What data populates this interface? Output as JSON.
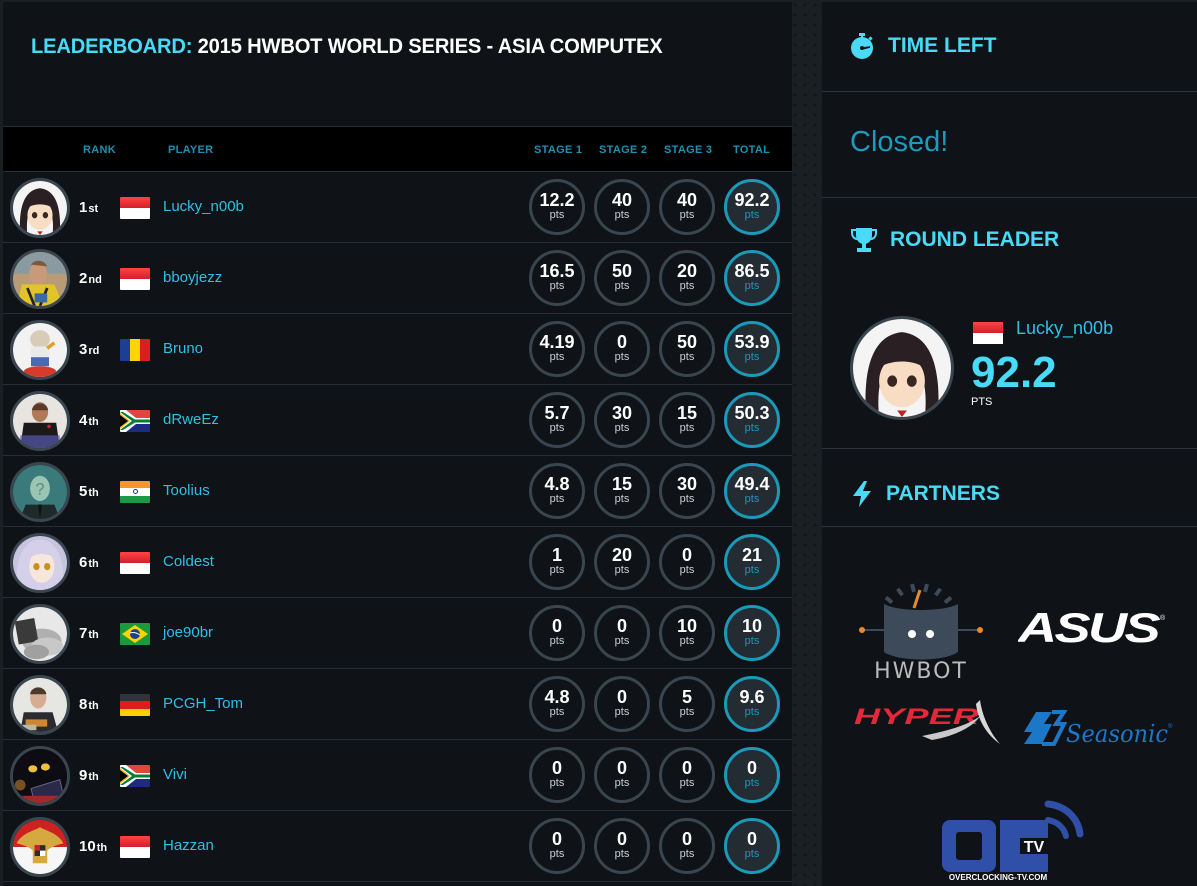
{
  "title": {
    "prefix": "LEADERBOARD:",
    "name": "2015 HWBOT WORLD SERIES - ASIA COMPUTEX"
  },
  "table": {
    "headers": {
      "rank": "RANK",
      "player": "PLAYER",
      "stage1": "STAGE 1",
      "stage2": "STAGE 2",
      "stage3": "STAGE 3",
      "total": "TOTAL"
    },
    "unit": "pts",
    "rows": [
      {
        "rank": "1",
        "suffix": "st",
        "flag": "indonesia",
        "player": "Lucky_n00b",
        "stage1": "12.2",
        "stage2": "40",
        "stage3": "40",
        "total": "92.2",
        "avatar": "anime-girl"
      },
      {
        "rank": "2",
        "suffix": "nd",
        "flag": "indonesia",
        "player": "bboyjezz",
        "stage1": "16.5",
        "stage2": "50",
        "stage3": "20",
        "total": "86.5",
        "avatar": "person-yellow-shirt"
      },
      {
        "rank": "3",
        "suffix": "rd",
        "flag": "romania",
        "player": "Bruno",
        "stage1": "4.19",
        "stage2": "0",
        "stage3": "50",
        "total": "53.9",
        "avatar": "cartoon-character"
      },
      {
        "rank": "4",
        "suffix": "th",
        "flag": "south-africa",
        "player": "dRweEz",
        "stage1": "5.7",
        "stage2": "30",
        "stage3": "15",
        "total": "50.3",
        "avatar": "man-black-shirt"
      },
      {
        "rank": "5",
        "suffix": "th",
        "flag": "india",
        "player": "Toolius",
        "stage1": "4.8",
        "stage2": "15",
        "stage3": "30",
        "total": "49.4",
        "avatar": "faceless-man"
      },
      {
        "rank": "6",
        "suffix": "th",
        "flag": "indonesia",
        "player": "Coldest",
        "stage1": "1",
        "stage2": "20",
        "stage3": "0",
        "total": "21",
        "avatar": "anime-silver-hair"
      },
      {
        "rank": "7",
        "suffix": "th",
        "flag": "brazil",
        "player": "joe90br",
        "stage1": "0",
        "stage2": "0",
        "stage3": "10",
        "total": "10",
        "avatar": "ln2-smoke"
      },
      {
        "rank": "8",
        "suffix": "th",
        "flag": "germany",
        "player": "PCGH_Tom",
        "stage1": "4.8",
        "stage2": "0",
        "stage3": "5",
        "total": "9.6",
        "avatar": "man-portrait"
      },
      {
        "rank": "9",
        "suffix": "th",
        "flag": "south-africa",
        "player": "Vivi",
        "stage1": "0",
        "stage2": "0",
        "stage3": "0",
        "total": "0",
        "avatar": "dark-glowing-eyes"
      },
      {
        "rank": "10",
        "suffix": "th",
        "flag": "indonesia",
        "player": "Hazzan",
        "stage1": "0",
        "stage2": "0",
        "stage3": "0",
        "total": "0",
        "avatar": "garuda-emblem"
      }
    ]
  },
  "sidebar": {
    "time_left": {
      "heading": "TIME LEFT",
      "icon": "stopwatch-icon",
      "status": "Closed!"
    },
    "round_leader": {
      "heading": "ROUND LEADER",
      "icon": "trophy-icon",
      "flag": "indonesia",
      "player": "Lucky_n00b",
      "score": "92.2",
      "unit": "PTS"
    },
    "partners": {
      "heading": "PARTNERS",
      "icon": "bolt-icon",
      "logos": [
        {
          "name": "HWBOT",
          "text": "HWBOT"
        },
        {
          "name": "ASUS",
          "text": "ASUS"
        },
        {
          "name": "HyperX",
          "text": "HYPER"
        },
        {
          "name": "Seasonic",
          "text": "Seasonic"
        },
        {
          "name": "Overclocking-TV",
          "text": "OC",
          "sub": "TV",
          "caption": "OVERCLOCKING-TV.COM"
        }
      ]
    }
  },
  "colors": {
    "accent": "#48daf6",
    "link": "#2ebfe6",
    "header_text": "#1f8fb3",
    "total_ring": "#1a9ab8",
    "ring": "#39464f",
    "panel": "#0f1317"
  }
}
